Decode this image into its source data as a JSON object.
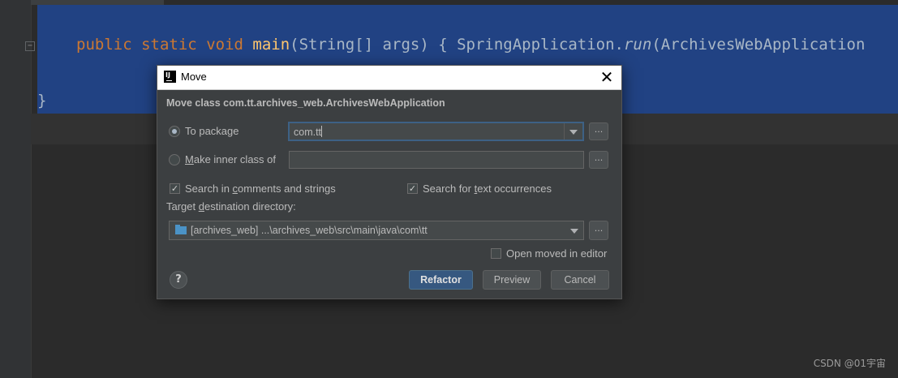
{
  "editor": {
    "code_line1": {
      "kw1": "public",
      "kw2": "static",
      "kw3": "void",
      "fn": "main",
      "rest1": "(String[] args) { SpringApplication.",
      "run": "run",
      "rest2": "(ArchivesWebApplication"
    },
    "code_line2": "}"
  },
  "dialog": {
    "title": "Move",
    "header": "Move class com.tt.archives_web.ArchivesWebApplication",
    "to_package_label": "To package",
    "to_package_selected": true,
    "package_value": "com.tt",
    "inner_class_label_m": "M",
    "inner_class_label_rest": "ake inner class of",
    "inner_class_selected": false,
    "inner_class_value": "",
    "browse_label": "...",
    "search_comments_label_pre": "Search in ",
    "search_comments_label_u": "c",
    "search_comments_label_post": "omments and strings",
    "search_comments_checked": true,
    "search_text_label_pre": "Search for ",
    "search_text_label_u": "t",
    "search_text_label_post": "ext occurrences",
    "search_text_checked": true,
    "target_dir_label_pre": "Target ",
    "target_dir_label_u": "d",
    "target_dir_label_post": "estination directory:",
    "target_dir_value": "[archives_web] ...\\archives_web\\src\\main\\java\\com\\tt",
    "open_in_editor_label": "Open moved in editor",
    "open_in_editor_checked": false,
    "help_label": "?",
    "buttons": {
      "refactor": "Refactor",
      "preview": "Preview",
      "cancel": "Cancel"
    }
  },
  "watermark": "CSDN @01宇宙",
  "colors": {
    "editor_bg": "#2b2b2b",
    "selection": "#214283",
    "dialog_bg": "#3c3f41",
    "primary_button": "#365880"
  }
}
